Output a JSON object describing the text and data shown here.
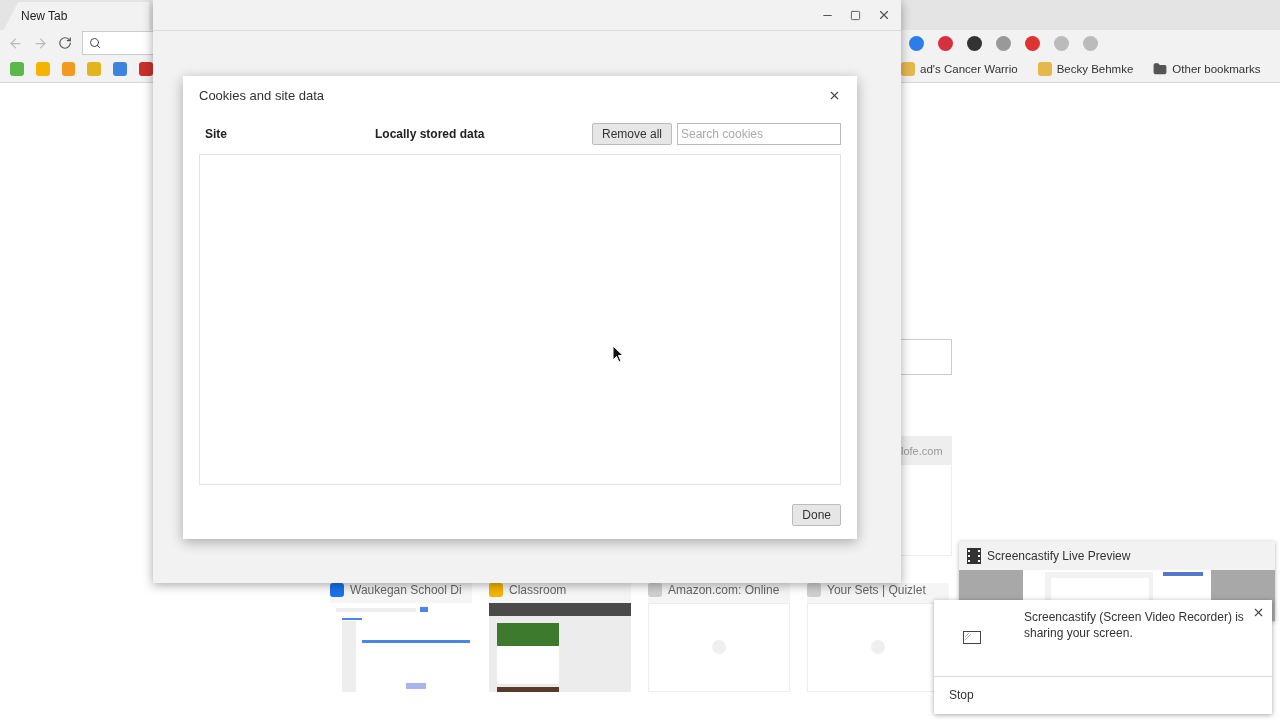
{
  "browser": {
    "tab": {
      "title": "New Tab"
    },
    "bookmarks": [
      {
        "label": "ad's Cancer Warrio",
        "kind": "site"
      },
      {
        "label": "Becky Behmke",
        "kind": "site"
      },
      {
        "label": "Other bookmarks",
        "kind": "folder"
      }
    ],
    "partial_tile": {
      "title": "lofe.com"
    },
    "thumbnails": [
      {
        "title": "Waukegan School Di",
        "kind": "calendar"
      },
      {
        "title": "Classroom",
        "kind": "classroom"
      },
      {
        "title": "Amazon.com: Online",
        "kind": "blank"
      },
      {
        "title": "Your Sets | Quizlet",
        "kind": "blank"
      }
    ]
  },
  "dialog": {
    "title": "Cookies and site data",
    "columns": [
      "Site",
      "Locally stored data"
    ],
    "remove_button": "Remove all",
    "search": {
      "placeholder": "Search cookies"
    },
    "done_button": "Done"
  },
  "preview_window": {
    "title": "Screencastify Live Preview"
  },
  "notification": {
    "message": "Screencastify (Screen Video Recorder) is sharing your screen.",
    "action": "Stop"
  }
}
